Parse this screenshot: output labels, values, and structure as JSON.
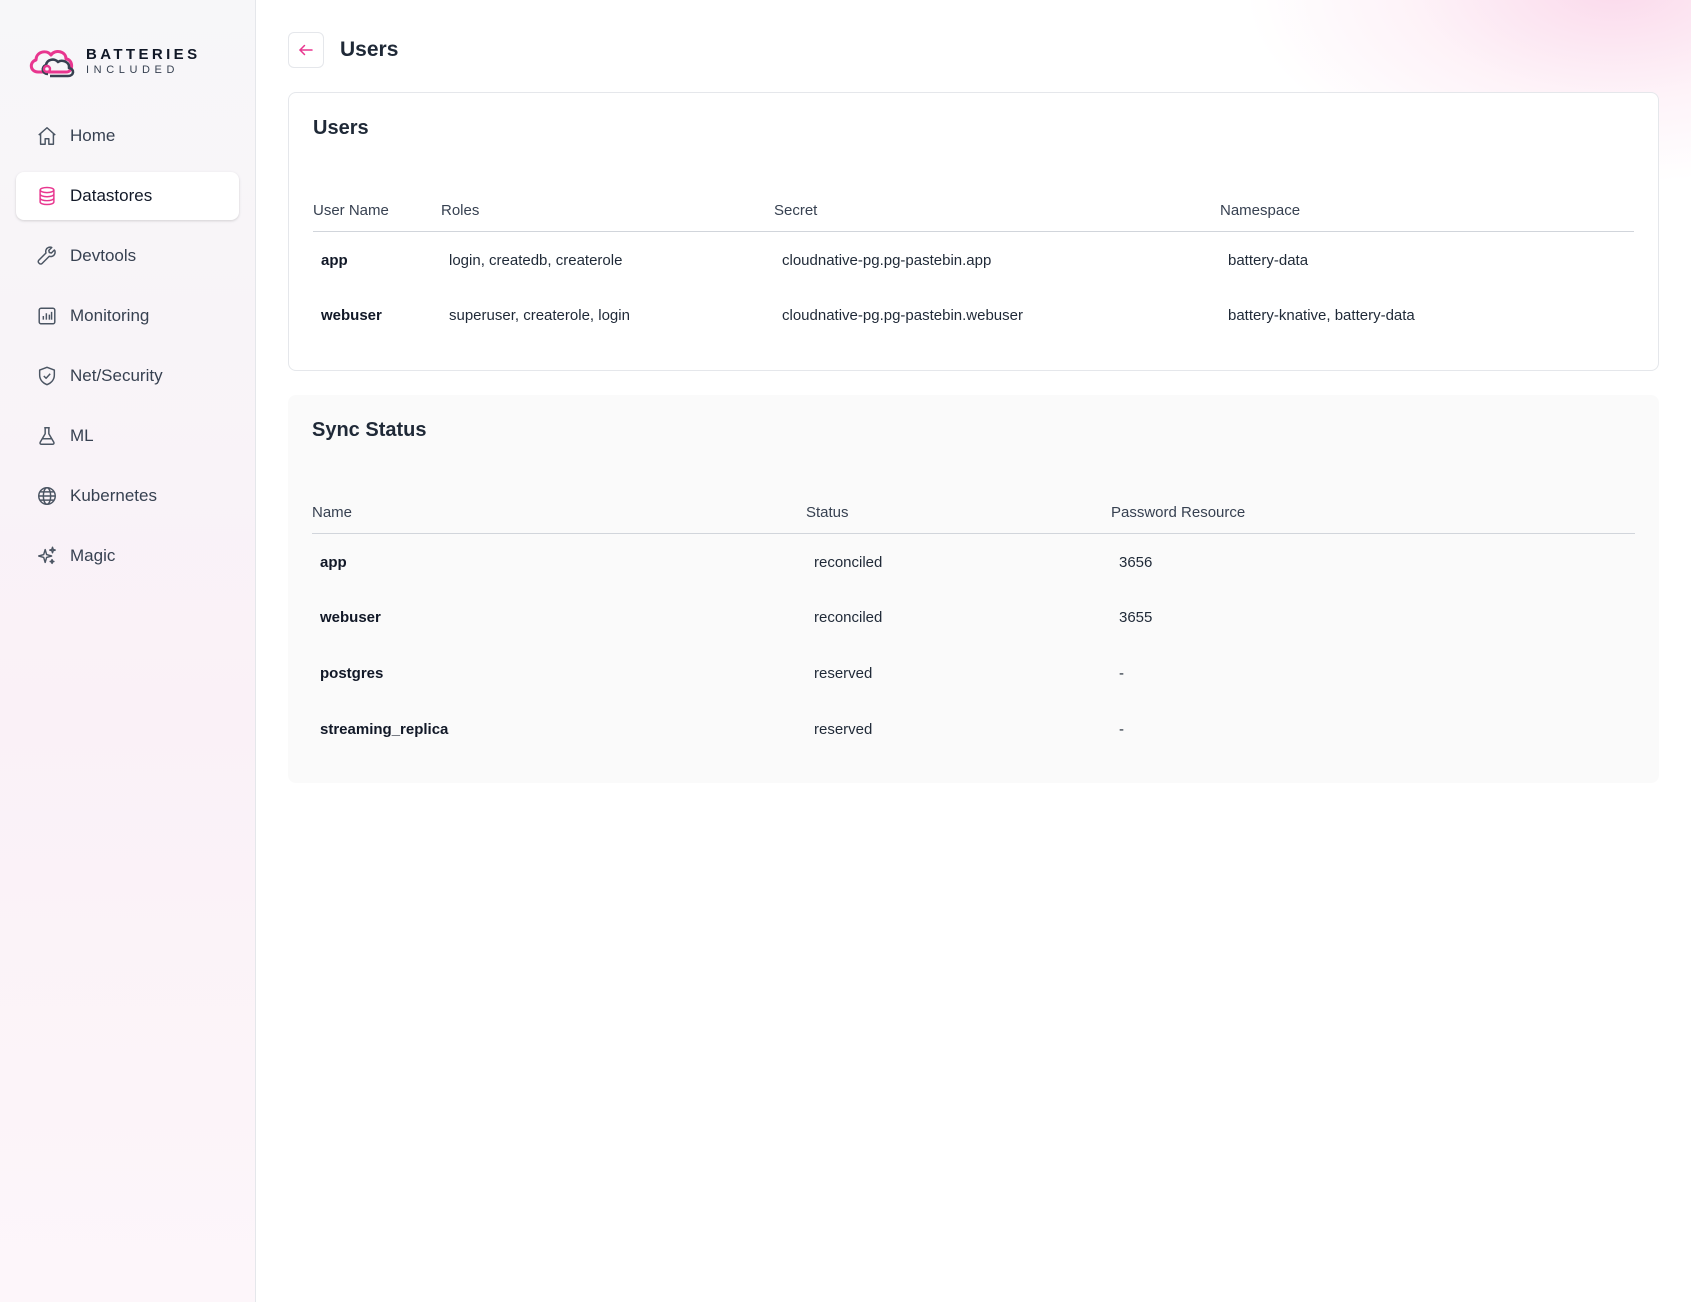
{
  "brand": {
    "line1": "BATTERIES",
    "line2": "INCLUDED",
    "accent": "#e8368f"
  },
  "sidebar": {
    "items": [
      {
        "label": "Home",
        "icon": "home-icon",
        "active": false
      },
      {
        "label": "Datastores",
        "icon": "database-icon",
        "active": true
      },
      {
        "label": "Devtools",
        "icon": "wrench-icon",
        "active": false
      },
      {
        "label": "Monitoring",
        "icon": "chart-icon",
        "active": false
      },
      {
        "label": "Net/Security",
        "icon": "shield-icon",
        "active": false
      },
      {
        "label": "ML",
        "icon": "flask-icon",
        "active": false
      },
      {
        "label": "Kubernetes",
        "icon": "globe-icon",
        "active": false
      },
      {
        "label": "Magic",
        "icon": "sparkles-icon",
        "active": false
      }
    ]
  },
  "header": {
    "title": "Users",
    "back_icon": "arrow-left-icon"
  },
  "users_panel": {
    "title": "Users",
    "columns": [
      "User Name",
      "Roles",
      "Secret",
      "Namespace"
    ],
    "rows": [
      [
        "app",
        "login, createdb, createrole",
        "cloudnative-pg.pg-pastebin.app",
        "battery-data"
      ],
      [
        "webuser",
        "superuser, createrole, login",
        "cloudnative-pg.pg-pastebin.webuser",
        "battery-knative, battery-data"
      ]
    ]
  },
  "sync_panel": {
    "title": "Sync Status",
    "columns": [
      "Name",
      "Status",
      "Password Resource"
    ],
    "rows": [
      [
        "app",
        "reconciled",
        "3656"
      ],
      [
        "webuser",
        "reconciled",
        "3655"
      ],
      [
        "postgres",
        "reserved",
        "-"
      ],
      [
        "streaming_replica",
        "reserved",
        "-"
      ]
    ]
  }
}
